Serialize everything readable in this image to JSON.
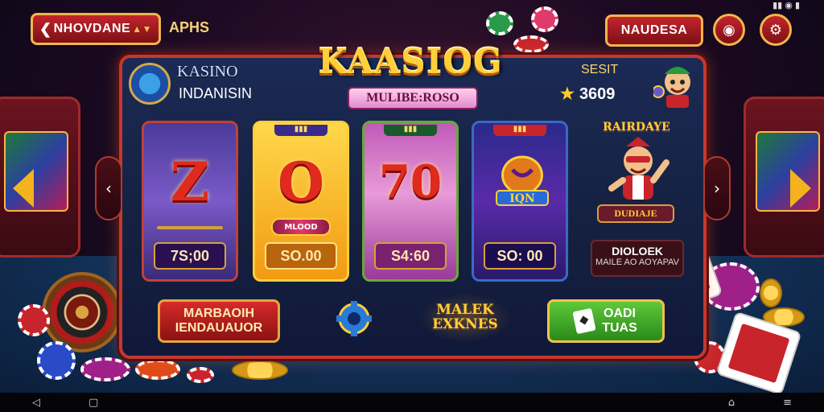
{
  "header": {
    "back_label": "NHOVDANE",
    "ap_text": "APHS",
    "right_pill_label": "NAUDESA"
  },
  "brand": {
    "title": "KASINO",
    "subtitle": "INDANISIN"
  },
  "game": {
    "title": "KAASIOG",
    "subtitle": "MULIBE:ROSO"
  },
  "account": {
    "label": "SESIT",
    "score": "3609"
  },
  "slots": [
    {
      "symbol": "Z",
      "value": "7S;00"
    },
    {
      "symbol": "O",
      "value": "SO.00",
      "ribbon": "MLOOD"
    },
    {
      "symbol": "70",
      "value": "S4:60"
    },
    {
      "symbol": "",
      "value": "SO: 00"
    }
  ],
  "side_promo": {
    "title": "RAIRDAYE",
    "subtitle": "DUDIAJE",
    "info_title": "DIOLOEK",
    "info_sub": "MAILE AO AOYAPAV"
  },
  "bottom": {
    "red_line1": "MARBAOIH",
    "red_line2": "IENDAUAUOR",
    "gold_line1": "MALEK",
    "gold_line2": "EXKNES",
    "green_line1": "OADI",
    "green_line2": "TUAS"
  },
  "icons": {
    "back": "chevron-left-icon",
    "settings": "gear-icon",
    "profile": "eye-icon",
    "gear_center": "gear-icon",
    "card": "card-icon"
  },
  "colors": {
    "panel_border": "#c23a2e",
    "accent_gold": "#ffcf3a",
    "button_red": "#c4242c",
    "button_green": "#5ec83a"
  }
}
